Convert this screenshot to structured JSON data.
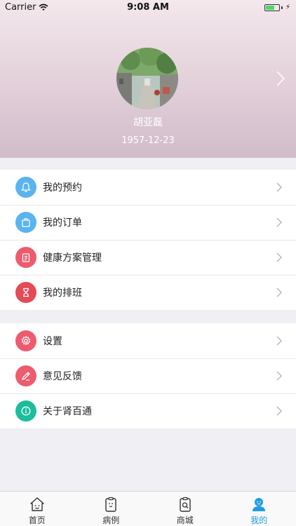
{
  "status_bar": {
    "carrier": "Carrier",
    "time": "9:08 AM"
  },
  "profile": {
    "name": "胡亚磊",
    "birthdate": "1957-12-23"
  },
  "menu_group_1": [
    {
      "label": "我的预约",
      "icon": "bell-icon",
      "color": "#5ab4f0"
    },
    {
      "label": "我的订单",
      "icon": "shopping-bag-icon",
      "color": "#5ab4f0"
    },
    {
      "label": "健康方案管理",
      "icon": "clipboard-icon",
      "color": "#ee5b6e"
    },
    {
      "label": "我的排班",
      "icon": "hourglass-icon",
      "color": "#e54a57"
    }
  ],
  "menu_group_2": [
    {
      "label": "设置",
      "icon": "gear-icon",
      "color": "#ee5b6e"
    },
    {
      "label": "意见反馈",
      "icon": "pen-icon",
      "color": "#ee5b6e"
    },
    {
      "label": "关于肾百通",
      "icon": "info-icon",
      "color": "#1bbd9c"
    }
  ],
  "tabbar": {
    "active_color": "#1e9ce0",
    "tabs": [
      {
        "label": "首页",
        "icon": "home-icon"
      },
      {
        "label": "病例",
        "icon": "medical-record-icon"
      },
      {
        "label": "商城",
        "icon": "shop-icon"
      },
      {
        "label": "我的",
        "icon": "user-icon",
        "active": true
      }
    ]
  }
}
